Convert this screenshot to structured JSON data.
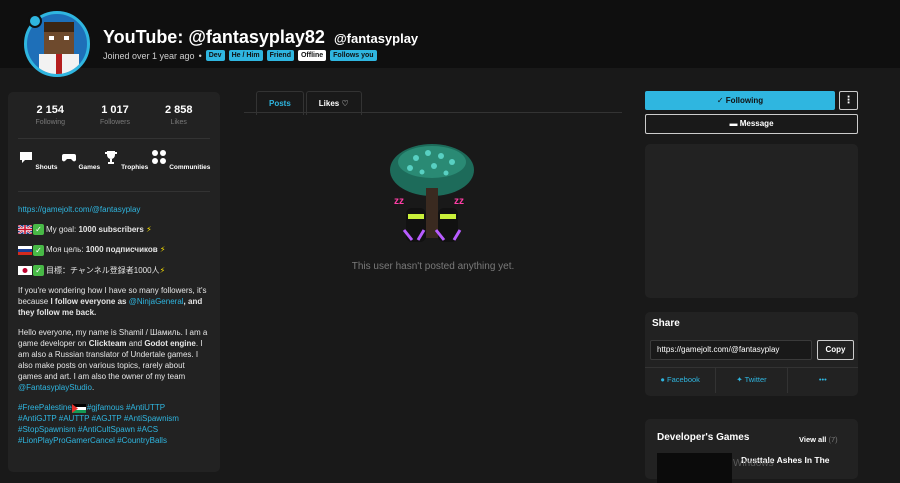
{
  "header": {
    "title": "YouTube: @fantasyplay82",
    "handle": "@fantasyplay",
    "joined": "Joined over 1 year ago",
    "bullet": "•",
    "tags": [
      "Dev",
      "He / Him",
      "Friend",
      "Offline",
      "Follows you"
    ]
  },
  "stats": [
    {
      "value": "2 154",
      "label": "Following"
    },
    {
      "value": "1 017",
      "label": "Followers"
    },
    {
      "value": "2 858",
      "label": "Likes"
    }
  ],
  "nav": [
    {
      "label": "Shouts",
      "icon": "chat-bubble-icon"
    },
    {
      "label": "Games",
      "icon": "gamepad-icon"
    },
    {
      "label": "Trophies",
      "icon": "trophy-icon"
    },
    {
      "label": "Communities",
      "icon": "communities-icon"
    }
  ],
  "bio": {
    "url": "https://gamejolt.com/@fantasyplay",
    "goal_en_prefix": "My goal: ",
    "goal_en_bold": "1000 subscribers",
    "goal_ru_prefix": "Моя цель: ",
    "goal_ru_bold": "1000 подписчиков",
    "goal_jp": "目標：チャンネル登録者1000人",
    "p1_a": "If you're wondering how I have so many followers, it's because ",
    "p1_b": "I follow everyone as",
    "p1_mention": "@NinjaGeneral",
    "p1_c": ", and they follow me back.",
    "p2_a": "Hello everyone, my name is Shamil / Шамиль. I am a game developer on ",
    "p2_b": "Clickteam",
    "p2_c": " and ",
    "p2_d": "Godot engine",
    "p2_e": ". I am also a Russian translator of Undertale games. I also make posts on various topics, rarely about games and art. I am also the owner of my team ",
    "p2_team": "@FantasyplayStudio",
    "p2_end": ".",
    "hashtags_1": "#FreePalestine",
    "hashtags_2": "#gjfamous #AntiUTTP",
    "hashtags_3": "#AntiGJTP #AUTTP #AGJTP #AntiSpawnism",
    "hashtags_4": "#StopSpawnism #AntiCultSpawn #ACS",
    "hashtags_5": "#LionPlayProGamerCancel #CountryBalls"
  },
  "tabs": [
    {
      "label": "Posts"
    },
    {
      "label": "Likes"
    }
  ],
  "empty": "This user hasn't posted anything yet.",
  "actions": {
    "following": "Following",
    "message": "Message",
    "more": "⋮"
  },
  "share": {
    "title": "Share",
    "url": "https://gamejolt.com/@fantasyplay",
    "copy": "Copy",
    "facebook": "Facebook",
    "twitter": "Twitter",
    "more": "•••"
  },
  "dev_games": {
    "title": "Developer's Games",
    "view_all": "View all",
    "count": "(7)",
    "first_game": "Dusttale Ashes In The"
  },
  "watermark": "Windows"
}
